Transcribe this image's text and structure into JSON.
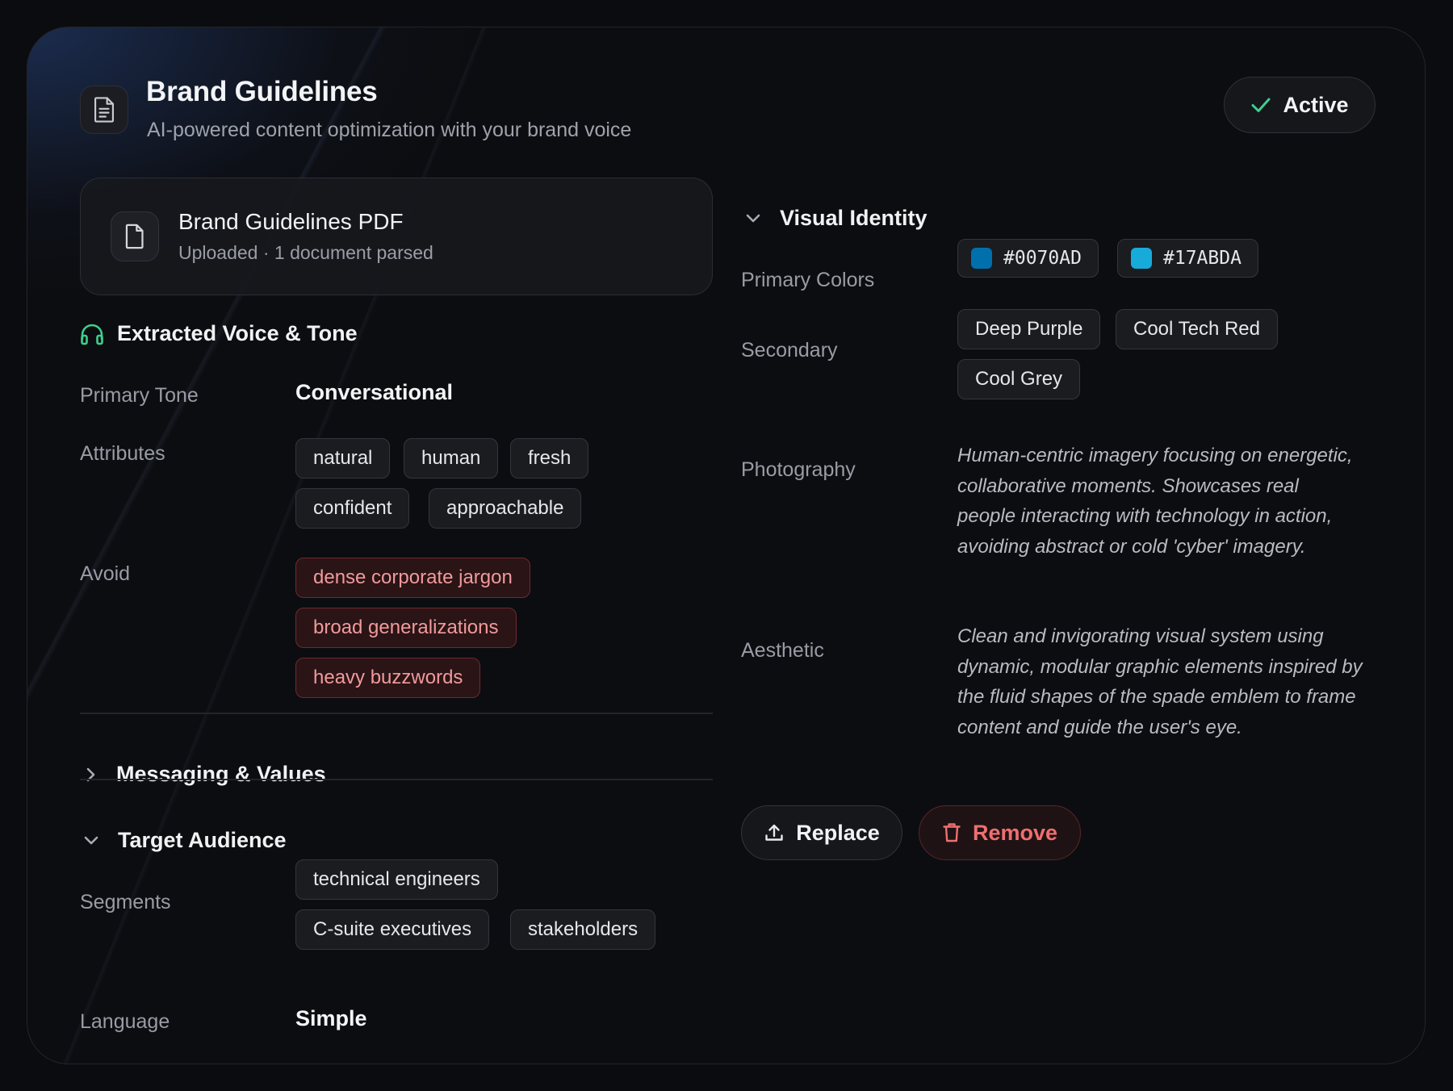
{
  "header": {
    "title": "Brand Guidelines",
    "subtitle": "AI-powered content optimization with your brand voice",
    "status": "Active"
  },
  "upload": {
    "file_name": "Brand Guidelines PDF",
    "file_status": "Uploaded · 1 document parsed"
  },
  "voice": {
    "heading": "Extracted Voice & Tone",
    "primary_tone_label": "Primary Tone",
    "primary_tone": "Conversational",
    "attributes_label": "Attributes",
    "attributes": [
      "natural",
      "human",
      "fresh",
      "confident",
      "approachable"
    ],
    "avoid_label": "Avoid",
    "avoid": [
      "dense corporate jargon",
      "broad generalizations",
      "heavy buzzwords"
    ]
  },
  "messaging": {
    "heading": "Messaging & Values"
  },
  "audience": {
    "heading": "Target Audience",
    "segments_label": "Segments",
    "segments": [
      "technical engineers",
      "C-suite executives",
      "stakeholders"
    ],
    "language_label": "Language",
    "language": "Simple"
  },
  "visual": {
    "heading": "Visual Identity",
    "primary_colors_label": "Primary Colors",
    "primary_colors": [
      {
        "hex": "#0070AD",
        "swatch": "#0070AD"
      },
      {
        "hex": "#17ABDA",
        "swatch": "#17ABDA"
      }
    ],
    "secondary_label": "Secondary",
    "secondary": [
      "Deep Purple",
      "Cool Tech Red",
      "Cool Grey"
    ],
    "photography_label": "Photography",
    "photography": "Human-centric imagery focusing on energetic, collaborative moments. Showcases real people interacting with technology in action, avoiding abstract or cold 'cyber' imagery.",
    "aesthetic_label": "Aesthetic",
    "aesthetic": "Clean and invigorating visual system using dynamic, modular graphic elements inspired by the fluid shapes of the spade emblem to frame content and guide the user's eye."
  },
  "actions": {
    "replace": "Replace",
    "remove": "Remove"
  },
  "theme": {
    "accent_green": "#3ecf8e",
    "danger": "#ee6f6f",
    "panel": "#0c0d10"
  }
}
